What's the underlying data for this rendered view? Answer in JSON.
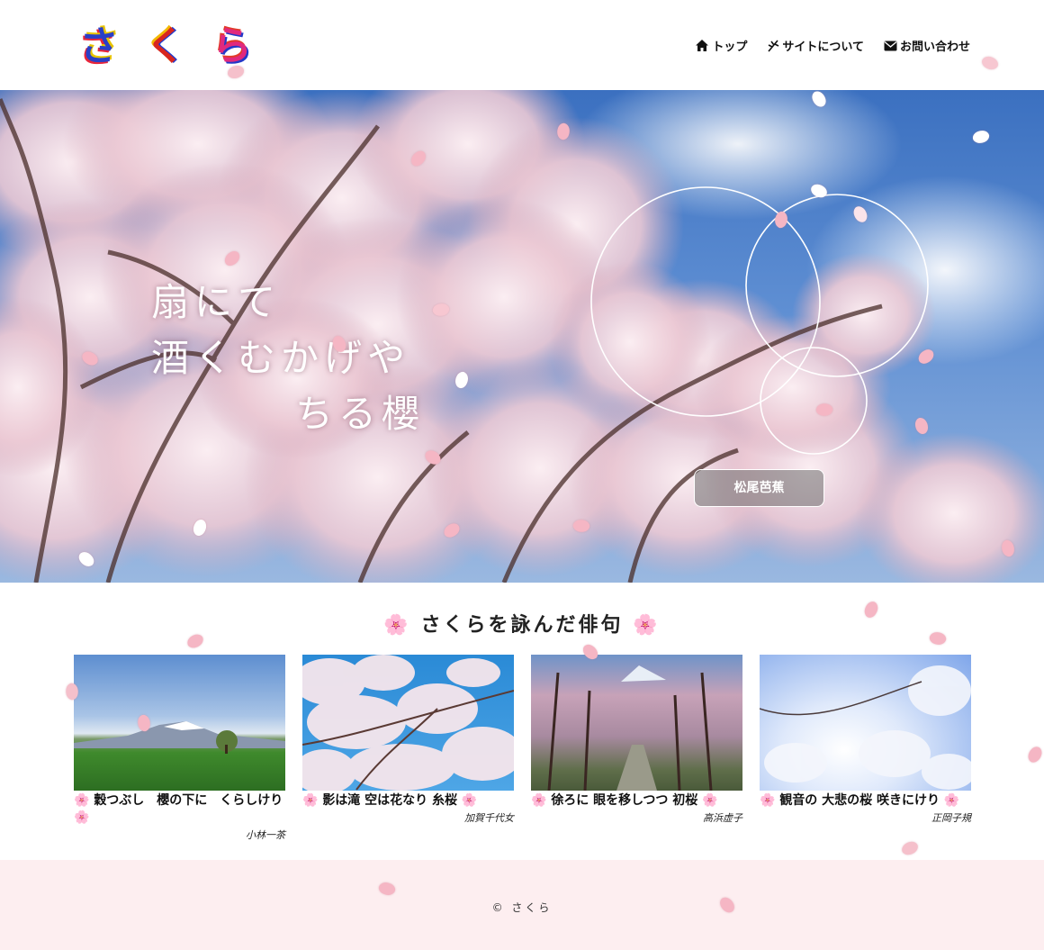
{
  "header": {
    "logo_chars": [
      "さ",
      "く",
      "ら"
    ],
    "nav": [
      {
        "label": "トップ",
        "icon": "home-icon"
      },
      {
        "label": "サイトについて",
        "icon": "sakura-branch-icon"
      },
      {
        "label": "お問い合わせ",
        "icon": "mail-icon"
      }
    ]
  },
  "hero": {
    "poem_lines": [
      "扇にて",
      "酒くむかげや",
      "ちる櫻"
    ],
    "author_button": "松尾芭蕉"
  },
  "section": {
    "title": "さくらを詠んだ俳句",
    "title_icon": "cherry-blossom-icon"
  },
  "haiku": [
    {
      "text": "穀つぶし　櫻の下に　くらしけり",
      "author": "小林一茶",
      "image": "mountain-field-photo"
    },
    {
      "text": "影は滝 空は花なり 糸桜",
      "author": "加賀千代女",
      "image": "blossom-sky-photo"
    },
    {
      "text": "徐ろに 眼を移しつつ 初桜",
      "author": "高浜虚子",
      "image": "blossom-avenue-photo"
    },
    {
      "text": "観音の 大悲の桜 咲きにけり",
      "author": "正岡子規",
      "image": "blossom-closeup-photo"
    }
  ],
  "footer": {
    "copyright": "© さくら"
  },
  "colors": {
    "accent_pink": "#f5b6c4",
    "footer_bg": "#fdeef0",
    "sky_blue": "#3b70c0"
  }
}
